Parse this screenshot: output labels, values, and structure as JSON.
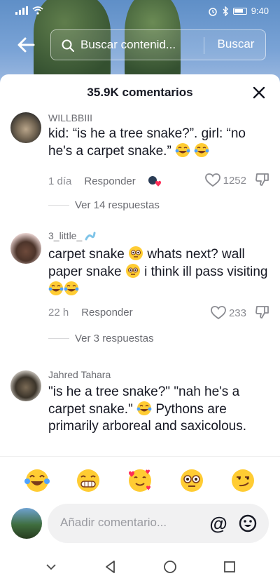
{
  "status_bar": {
    "time": "9:40"
  },
  "search": {
    "placeholder": "Buscar contenid...",
    "button_label": "Buscar"
  },
  "sheet": {
    "title": "35.9K comentarios"
  },
  "comments": [
    {
      "username": "WILLBBIII",
      "text": "kid: “is he a tree snake?”. girl: “no he's a carpet snake.”",
      "trailing_emoji": [
        "laughing-crying",
        "laughing-crying"
      ],
      "time": "1 día",
      "reply_label": "Responder",
      "likes": "1252",
      "creator_liked": true,
      "replies_label": "Ver 14 respuestas"
    },
    {
      "username": "3_little_",
      "text_parts": [
        "carpet snake ",
        " whats next? wall paper snake ",
        " i think ill pass visiting "
      ],
      "time": "22 h",
      "reply_label": "Responder",
      "likes": "233",
      "replies_label": "Ver 3 respuestas"
    },
    {
      "username": "Jahred Tahara",
      "text_parts": [
        "\"is he a tree snake?\" \"nah he's a carpet snake.\" ",
        " Pythons are primarily arboreal and saxicolous."
      ],
      "time": "",
      "likes": ""
    }
  ],
  "emoji_bar": [
    "laughing-crying",
    "grinning",
    "smiling-hearts",
    "flushed",
    "smirking"
  ],
  "composer": {
    "placeholder": "Añadir comentario...",
    "at_label": "@"
  },
  "colors": {
    "accent": "#fe2c55",
    "text": "#161823",
    "muted": "#8a8b91"
  }
}
